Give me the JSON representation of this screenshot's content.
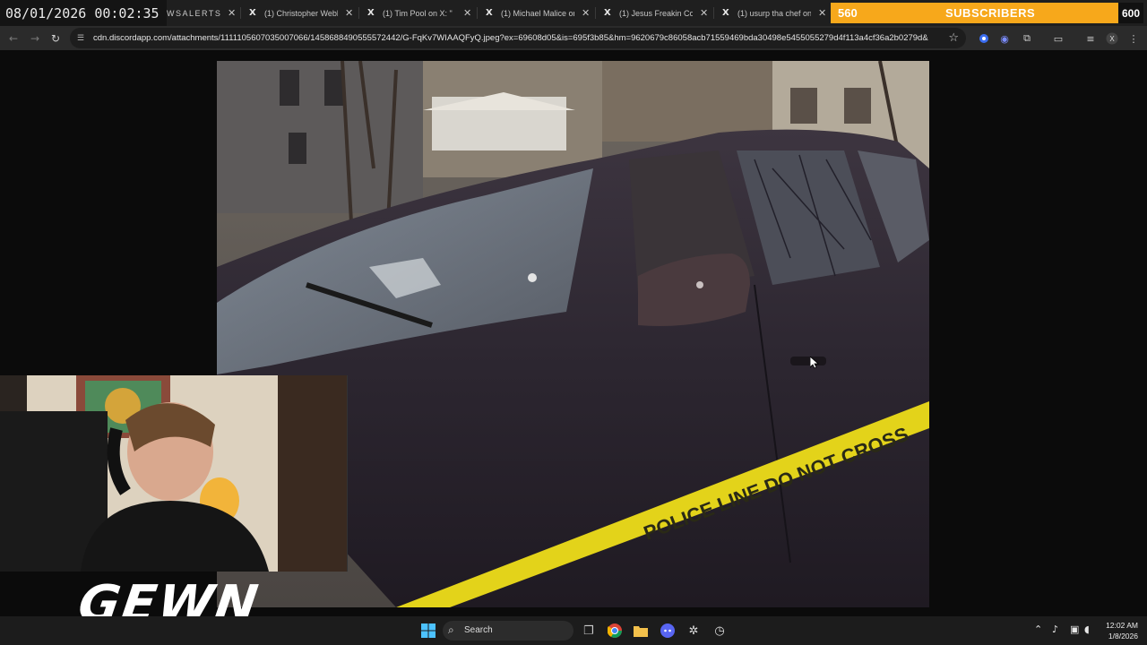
{
  "stream_overlay": {
    "datetime": "08/01/2026 00:02:35",
    "subscriber_count": "560",
    "subscriber_label": "SUBSCRIBERS",
    "subscriber_goal": "600",
    "brand": "GEWN",
    "colors": {
      "sub_bar": "#f7a81b"
    }
  },
  "browser": {
    "tabs": [
      {
        "label": "WSALERTS",
        "icon": "newsalerts-icon"
      },
      {
        "label": "(1) Christopher Webb o",
        "icon": "x-logo-icon"
      },
      {
        "label": "(1) Tim Pool on X: \"",
        "icon": "x-logo-icon"
      },
      {
        "label": "(1) Michael Malice on X",
        "icon": "x-logo-icon"
      },
      {
        "label": "(1) Jesus Freakin Congr",
        "icon": "x-logo-icon"
      },
      {
        "label": "(1) usurp tha chef on X",
        "icon": "x-logo-icon"
      }
    ],
    "url": "cdn.discordapp.com/attachments/1111105607035007066/1458688490555572442/G-FqKv7WIAAQFyQ.jpeg?ex=69608d05&is=695f3b85&hm=9620679c86058acb71559469bda30498e5455055279d4f113a4cf36a2b0279d&",
    "toolbar_icons": [
      "extension-icon-1",
      "extension-icon-2",
      "puzzle-icon",
      "side-panel-icon",
      "reading-list-icon",
      "profile-icon",
      "menu-icon"
    ]
  },
  "taskbar": {
    "search_label": "Search",
    "apps": [
      "windows-start-icon",
      "task-view-icon",
      "chrome-icon",
      "file-explorer-icon",
      "discord-icon",
      "app-icon",
      "clock-app-icon"
    ],
    "time": "12:02 AM",
    "date": "1/8/2026"
  },
  "photo": {
    "tape_text": "POLICE LINE DO NOT CROSS"
  }
}
